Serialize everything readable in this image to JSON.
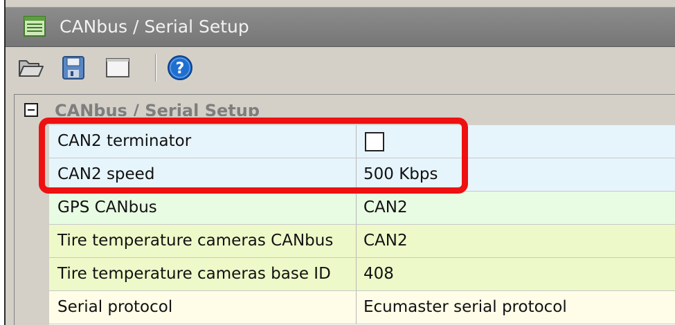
{
  "window": {
    "title": "CANbus / Serial Setup"
  },
  "toolbar": {
    "buttons": [
      {
        "icon": "open-folder-icon"
      },
      {
        "icon": "save-icon"
      },
      {
        "icon": "window-icon"
      },
      {
        "icon": "help-icon"
      }
    ]
  },
  "grid": {
    "category": "CANbus / Serial Setup",
    "rows": [
      {
        "name": "CAN2 terminator",
        "value": "",
        "type": "checkbox",
        "checked": false,
        "color": "#e6f5fb"
      },
      {
        "name": "CAN2 speed",
        "value": "500 Kbps",
        "type": "text",
        "color": "#e6f5fb"
      },
      {
        "name": "GPS CANbus",
        "value": "CAN2",
        "type": "text",
        "color": "#e8fbe3"
      },
      {
        "name": "Tire temperature cameras CANbus",
        "value": "CAN2",
        "type": "text",
        "color": "#eef9c9"
      },
      {
        "name": "Tire temperature cameras base ID",
        "value": "408",
        "type": "text",
        "color": "#eef9c9"
      },
      {
        "name": "Serial protocol",
        "value": "Ecumaster serial protocol",
        "type": "text",
        "color": "#fffde8"
      }
    ]
  },
  "colors": {
    "titlebar": "#808080",
    "highlight": "#ee1111",
    "help_icon": "#1f6fd0"
  }
}
